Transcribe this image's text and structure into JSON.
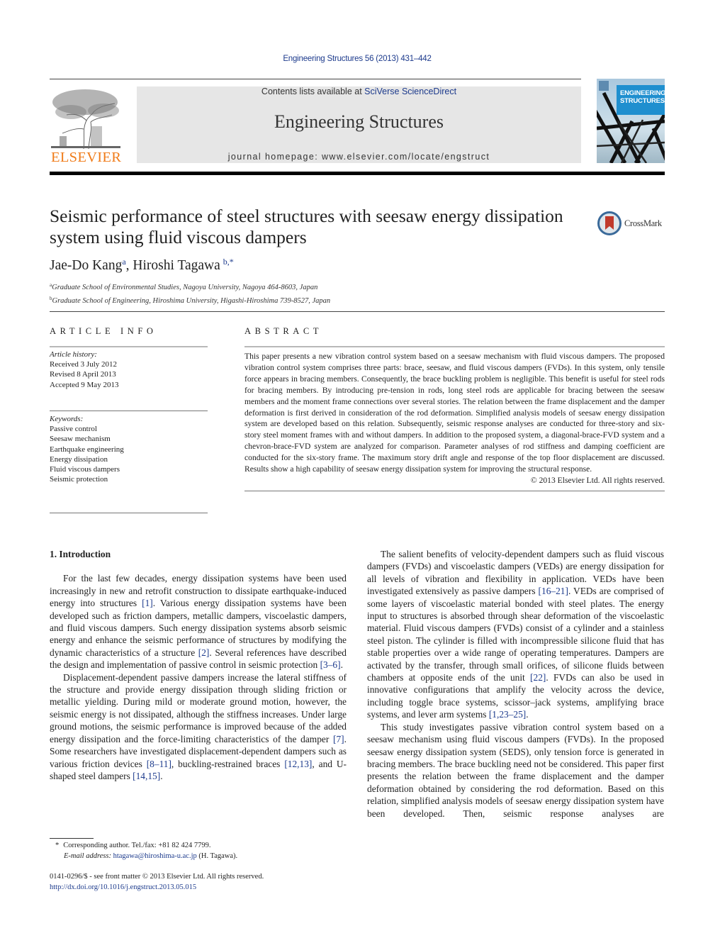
{
  "header": {
    "running_head": "Engineering Structures 56 (2013) 431–442",
    "publisher_logo_text": "ELSEVIER",
    "contents_prefix": "Contents lists available at ",
    "contents_link": "SciVerse ScienceDirect",
    "journal_name": "Engineering Structures",
    "homepage_prefix": "journal homepage: ",
    "homepage_url": "www.elsevier.com/locate/engstruct",
    "cover_title_line1": "ENGINEERING",
    "cover_title_line2": "STRUCTURES"
  },
  "article": {
    "title": "Seismic performance of steel structures with seesaw energy dissipation system using fluid viscous dampers",
    "crossmark_label": "CrossMark",
    "authors": [
      {
        "name": "Jae-Do Kang",
        "sup": "a"
      },
      {
        "name": "Hiroshi Tagawa",
        "sup": "b,*"
      }
    ],
    "author_separator": ", ",
    "affiliations": [
      {
        "sup": "a",
        "text": "Graduate School of Environmental Studies, Nagoya University, Nagoya 464-8603, Japan"
      },
      {
        "sup": "b",
        "text": "Graduate School of Engineering, Hiroshima University, Higashi-Hiroshima 739-8527, Japan"
      }
    ]
  },
  "article_info": {
    "heading": "ARTICLE INFO",
    "history_label": "Article history:",
    "history": [
      "Received 3 July 2012",
      "Revised 8 April 2013",
      "Accepted 9 May 2013"
    ],
    "keywords_label": "Keywords:",
    "keywords": [
      "Passive control",
      "Seesaw mechanism",
      "Earthquake engineering",
      "Energy dissipation",
      "Fluid viscous dampers",
      "Seismic protection"
    ]
  },
  "abstract": {
    "heading": "ABSTRACT",
    "text": "This paper presents a new vibration control system based on a seesaw mechanism with fluid viscous dampers. The proposed vibration control system comprises three parts: brace, seesaw, and fluid viscous dampers (FVDs). In this system, only tensile force appears in bracing members. Consequently, the brace buckling problem is negligible. This benefit is useful for steel rods for bracing members. By introducing pre-tension in rods, long steel rods are applicable for bracing between the seesaw members and the moment frame connections over several stories. The relation between the frame displacement and the damper deformation is first derived in consideration of the rod deformation. Simplified analysis models of seesaw energy dissipation system are developed based on this relation. Subsequently, seismic response analyses are conducted for three-story and six-story steel moment frames with and without dampers. In addition to the proposed system, a diagonal-brace-FVD system and a chevron-brace-FVD system are analyzed for comparison. Parameter analyses of rod stiffness and damping coefficient are conducted for the six-story frame. The maximum story drift angle and response of the top floor displacement are discussed. Results show a high capability of seesaw energy dissipation system for improving the structural response.",
    "copyright": "© 2013 Elsevier Ltd. All rights reserved."
  },
  "body": {
    "section_heading": "1. Introduction",
    "left_paragraphs": [
      [
        {
          "t": "For the last few decades, energy dissipation systems have been used increasingly in new and retrofit construction to dissipate earthquake-induced energy into structures "
        },
        {
          "ref": "[1]"
        },
        {
          "t": ". Various energy dissipation systems have been developed such as friction dampers, metallic dampers, viscoelastic dampers, and fluid viscous dampers. Such energy dissipation systems absorb seismic energy and enhance the seismic performance of structures by modifying the dynamic characteristics of a structure "
        },
        {
          "ref": "[2]"
        },
        {
          "t": ". Several references have described the design and implementation of passive control in seismic protection "
        },
        {
          "ref": "[3–6]"
        },
        {
          "t": "."
        }
      ],
      [
        {
          "t": "Displacement-dependent passive dampers increase the lateral stiffness of the structure and provide energy dissipation through sliding friction or metallic yielding. During mild or moderate ground motion, however, the seismic energy is not dissipated, although the stiffness increases. Under large ground motions, the seismic performance is improved because of the added energy dissipation and the force-limiting characteristics of the damper "
        },
        {
          "ref": "[7]"
        },
        {
          "t": ". Some researchers have investigated displacement-dependent dampers such as various friction devices "
        },
        {
          "ref": "[8–11]"
        },
        {
          "t": ", buckling-restrained braces "
        },
        {
          "ref": "[12,13]"
        },
        {
          "t": ", and U-shaped steel dampers "
        },
        {
          "ref": "[14,15]"
        },
        {
          "t": "."
        }
      ]
    ],
    "right_paragraphs": [
      [
        {
          "t": "The salient benefits of velocity-dependent dampers such as fluid viscous dampers (FVDs) and viscoelastic dampers (VEDs) are energy dissipation for all levels of vibration and flexibility in application. VEDs have been investigated extensively as passive dampers "
        },
        {
          "ref": "[16–21]"
        },
        {
          "t": ". VEDs are comprised of some layers of viscoelastic material bonded with steel plates. The energy input to structures is absorbed through shear deformation of the viscoelastic material. Fluid viscous dampers (FVDs) consist of a cylinder and a stainless steel piston. The cylinder is filled with incompressible silicone fluid that has stable properties over a wide range of operating temperatures. Dampers are activated by the transfer, through small orifices, of silicone fluids between chambers at opposite ends of the unit "
        },
        {
          "ref": "[22]"
        },
        {
          "t": ". FVDs can also be used in innovative configurations that amplify the velocity across the device, including toggle brace systems, scissor–jack systems, amplifying brace systems, and lever arm systems "
        },
        {
          "ref": "[1,23–25]"
        },
        {
          "t": "."
        }
      ],
      [
        {
          "t": "This study investigates passive vibration control system based on a seesaw mechanism using fluid viscous dampers (FVDs). In the proposed seesaw energy dissipation system (SEDS), only tension force is generated in bracing members. The brace buckling need not be considered. This paper first presents the relation between the frame displacement and the damper deformation obtained by considering the rod deformation. Based on this relation, simplified analysis models of seesaw energy dissipation system have been developed. Then, seismic response analyses are"
        }
      ]
    ]
  },
  "footnotes": {
    "star": "*",
    "corresponding": "Corresponding author. Tel./fax: +81 82 424 7799.",
    "email_label": "E-mail address:",
    "email": "htagawa@hiroshima-u.ac.jp",
    "email_suffix": " (H. Tagawa).",
    "front_matter": "0141-0296/$ - see front matter © 2013 Elsevier Ltd. All rights reserved.",
    "doi": "http://dx.doi.org/10.1016/j.engstruct.2013.05.015"
  },
  "colors": {
    "link": "#1c3a8c",
    "elsevier_orange": "#f07c1a",
    "masthead_gray": "#e6e6e6",
    "cover_blue": "#1f8fcf"
  }
}
